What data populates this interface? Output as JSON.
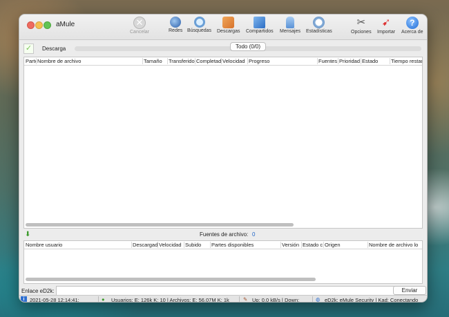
{
  "window": {
    "title": "aMule"
  },
  "toolbar": {
    "cancel": "Cancelar",
    "networks": "Redes",
    "searches": "Búsquedas",
    "downloads": "Descargas",
    "shared": "Compartidos",
    "messages": "Mensajes",
    "statistics": "Estadísticas",
    "options": "Opciones",
    "import": "Importar",
    "about": "Acerca de"
  },
  "downloads": {
    "label": "Descarga",
    "filter_button": "Todo (0/0)",
    "columns": [
      "Parte",
      "Nombre de archivo",
      "Tamaño",
      "Transferido",
      "Completado",
      "Velocidad",
      "Progreso",
      "Fuentes",
      "Prioridad",
      "Estado",
      "Tiempo restante"
    ]
  },
  "sources": {
    "label": "Fuentes de archivo:",
    "count": "0",
    "columns": [
      "Nombre usuario",
      "Descargado",
      "Velocidad",
      "Subido",
      "Partes disponibles",
      "Versión",
      "Estado c",
      "Origen",
      "Nombre de archivo lo"
    ]
  },
  "ed2k": {
    "label": "Enlace eD2k:",
    "value": "",
    "send_button": "Enviar"
  },
  "statusbar": {
    "timestamp": "2021-05-28 12:14:41:",
    "users": "Usuarios: E: 126k K: 10 | Archivos: E: 56.07M K: 1k",
    "traffic": "Up: 0.0 kB/s | Down:",
    "network": "eD2k: eMule Security | Kad: Conectando"
  },
  "colors": {
    "accent": "#1d64c8",
    "close": "#ee6b5f",
    "minimize": "#f5bf4f",
    "zoom": "#61c454"
  }
}
